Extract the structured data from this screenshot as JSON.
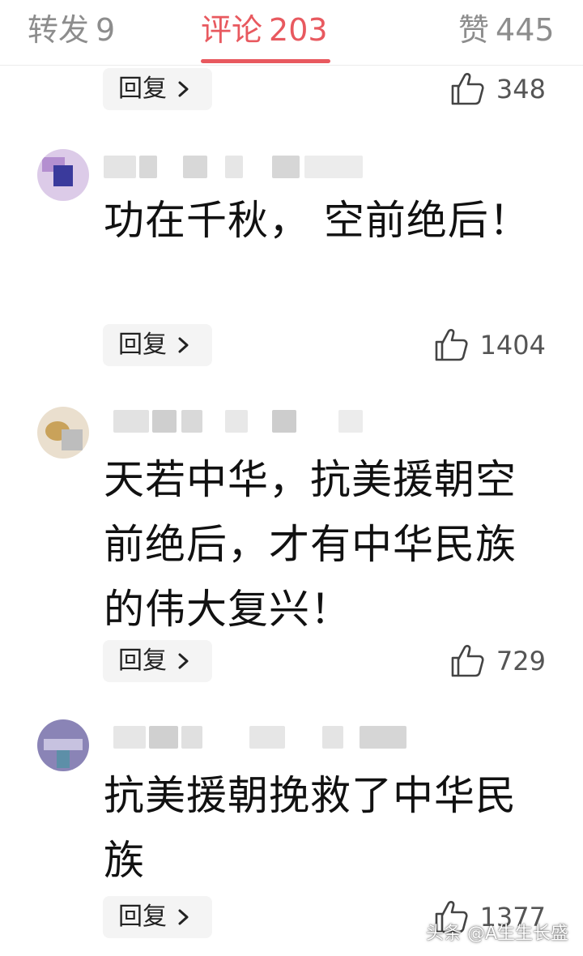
{
  "tabs": {
    "repost": {
      "label": "转发",
      "count": "9"
    },
    "comments": {
      "label": "评论",
      "count": "203"
    },
    "likes": {
      "label": "赞",
      "count": "445"
    }
  },
  "colors": {
    "accent": "#e8595f",
    "inactive_tab": "#8d8d8d",
    "reply_bg": "#f4f4f4"
  },
  "icons": {
    "thumb": "thumbs-up-icon",
    "chevron": "chevron-right-icon"
  },
  "comments": [
    {
      "text": "",
      "reply_label": "回复",
      "likes": "348"
    },
    {
      "text": "功在千秋， 空前绝后！",
      "reply_label": "回复",
      "likes": "1404"
    },
    {
      "text": "天若中华，抗美援朝空前绝后，才有中华民族的伟大复兴！",
      "reply_label": "回复",
      "likes": "729"
    },
    {
      "text": "抗美援朝挽救了中华民族",
      "reply_label": "回复",
      "likes": "1377"
    }
  ],
  "watermark": "头条 @A生生长盛"
}
